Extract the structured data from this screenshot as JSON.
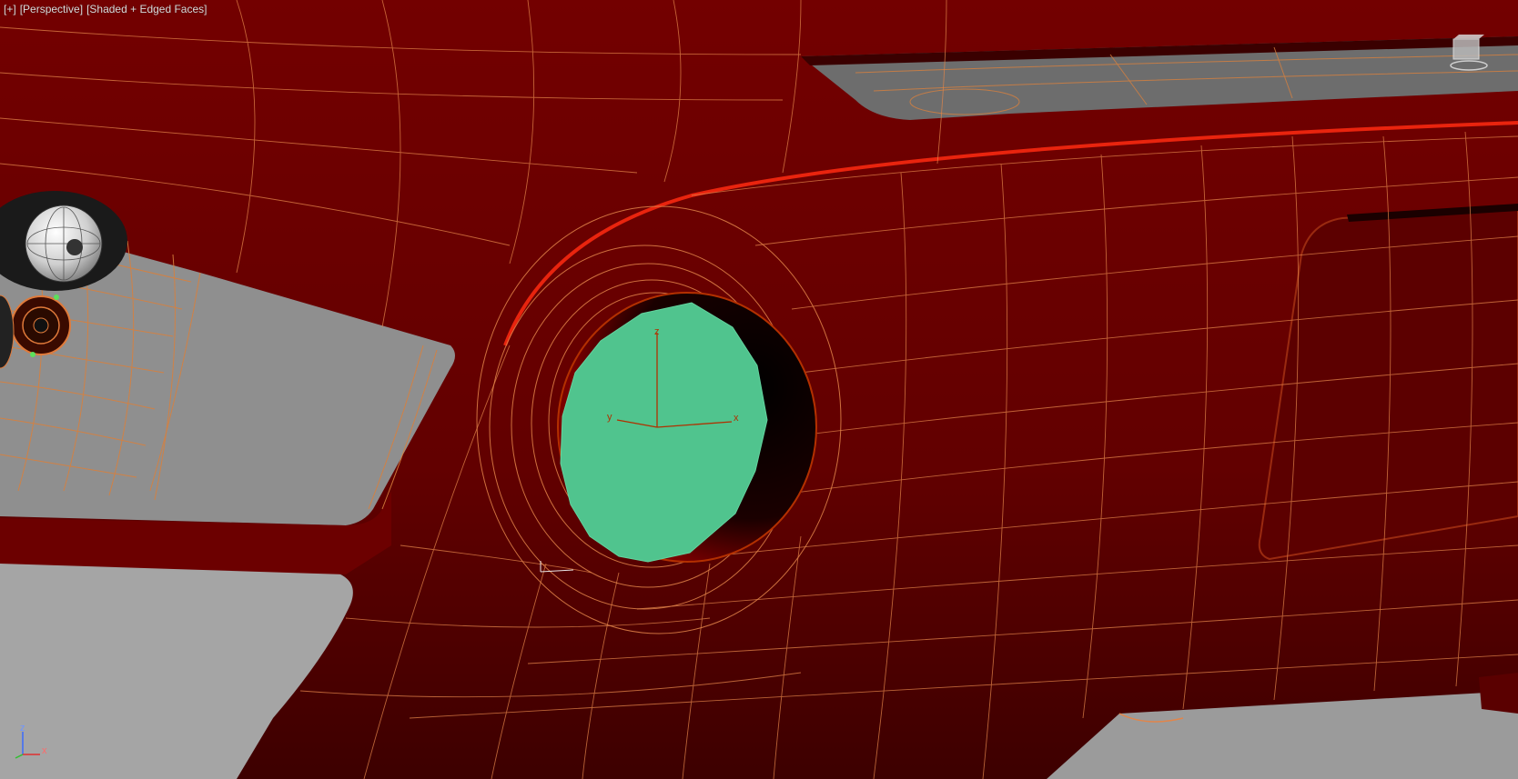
{
  "viewport": {
    "menu_plus": "[+]",
    "view_label": "[Perspective]",
    "shading_label": "[Shaded + Edged Faces]"
  },
  "gizmo": {
    "x_label": "x",
    "y_label": "y",
    "z_label": "z"
  },
  "world_axis": {
    "x_label": "x",
    "z_label": "z"
  },
  "view_cube": {
    "icon": "view-cube-icon"
  },
  "colors": {
    "body_paint": "#7a0000",
    "wire_edges": "#e07a3a",
    "selection": "#50c48e",
    "background": "#9a9a9a"
  }
}
